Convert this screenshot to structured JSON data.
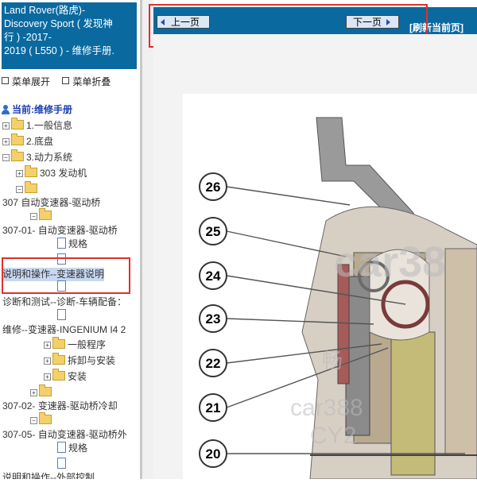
{
  "sidebar": {
    "title": "Land Rover(路虎)-\nDiscovery Sport ( 发现神\n行 ) -2017-\n2019 ( L550 ) - 维修手册.",
    "expand_label": "菜单展开",
    "collapse_label": "菜单折叠",
    "current_label": "当前:维修手册",
    "items": [
      {
        "label": "1.一般信息"
      },
      {
        "label": "2.底盘"
      },
      {
        "label": "3.动力系统"
      },
      {
        "label": "303 发动机"
      },
      {
        "label": ""
      },
      {
        "label": "307 自动变速器-驱动桥"
      },
      {
        "label": ""
      },
      {
        "label": "307-01- 自动变速器-驱动桥"
      },
      {
        "label": "规格"
      },
      {
        "label": ""
      },
      {
        "label": "说明和操作--变速器说明"
      },
      {
        "label": ""
      },
      {
        "label": "诊断和测试--诊断-车辆配备："
      },
      {
        "label": ""
      },
      {
        "label": "维修--变速器-INGENIUM I4 2"
      },
      {
        "label": "一般程序"
      },
      {
        "label": "拆卸与安装"
      },
      {
        "label": "安装"
      },
      {
        "label": ""
      },
      {
        "label": "307-02- 变速器-驱动桥冷却"
      },
      {
        "label": ""
      },
      {
        "label": "307-05- 自动变速器-驱动桥外"
      },
      {
        "label": "规格"
      },
      {
        "label": ""
      },
      {
        "label": "说明和操作--外部控制"
      }
    ]
  },
  "toolbar": {
    "prev_label": "上一页",
    "next_label": "下一页",
    "refresh_label": "[刷新当前页]"
  },
  "diagram": {
    "callouts": [
      "26",
      "25",
      "24",
      "23",
      "22",
      "21",
      "20"
    ],
    "watermarks": [
      "car38",
      "畅",
      "car388",
      "CY2"
    ]
  }
}
